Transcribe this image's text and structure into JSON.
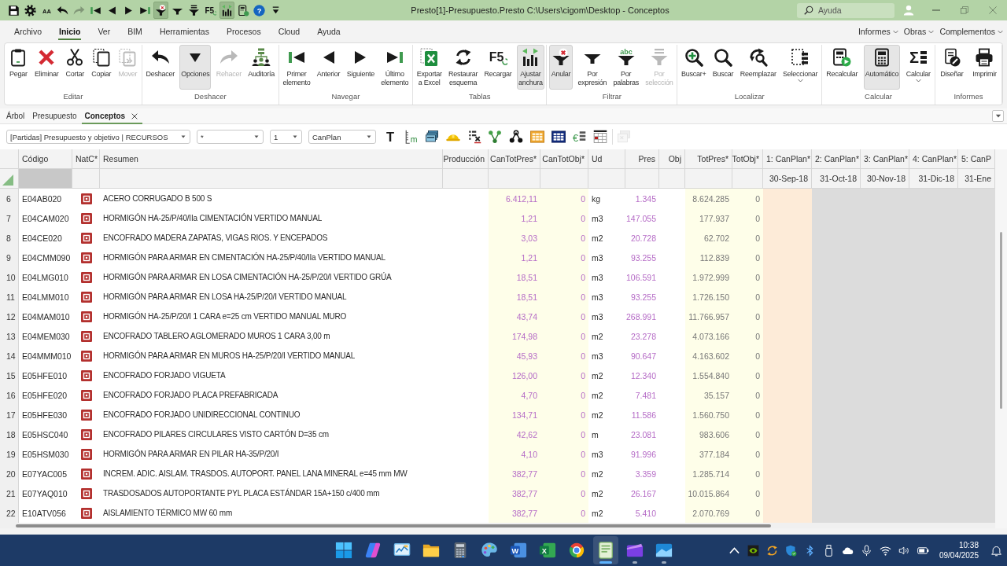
{
  "title_bar": {
    "quick_access": [
      {
        "kind": "save",
        "pressed": false,
        "disabled": false
      },
      {
        "kind": "settings",
        "pressed": false,
        "disabled": false
      },
      {
        "kind": "font_size",
        "glyph": "AA",
        "pressed": false,
        "disabled": false
      },
      {
        "kind": "undo",
        "pressed": false,
        "disabled": false
      },
      {
        "kind": "redo",
        "pressed": false,
        "disabled": true
      },
      {
        "kind": "first",
        "pressed": false,
        "disabled": false
      },
      {
        "kind": "previous",
        "pressed": false,
        "disabled": false
      },
      {
        "kind": "next",
        "pressed": false,
        "disabled": false
      },
      {
        "kind": "last",
        "pressed": false,
        "disabled": false
      },
      {
        "kind": "clear_filter",
        "pressed": true,
        "disabled": false
      },
      {
        "kind": "filter_expression",
        "pressed": false,
        "disabled": false
      },
      {
        "kind": "filter_words",
        "pressed": false,
        "disabled": false
      },
      {
        "kind": "reload",
        "glyph": "F5",
        "pressed": false,
        "disabled": false
      },
      {
        "kind": "fit_width",
        "pressed": true,
        "disabled": false
      },
      {
        "kind": "calc_sheet",
        "pressed": false,
        "disabled": false
      },
      {
        "kind": "help",
        "glyph": "?",
        "pressed": false,
        "disabled": false
      },
      {
        "kind": "customize",
        "pressed": false,
        "disabled": false
      }
    ],
    "title": "Presto[1]-Presupuesto.Presto C:\\Users\\cigom\\Desktop - Conceptos",
    "search": {
      "placeholder": "Ayuda"
    }
  },
  "menu_bar": {
    "tabs": [
      {
        "label": "Archivo",
        "selected": false
      },
      {
        "label": "Inicio",
        "selected": true
      },
      {
        "label": "Ver",
        "selected": false
      },
      {
        "label": "BIM",
        "selected": false
      },
      {
        "label": "Herramientas",
        "selected": false
      },
      {
        "label": "Procesos",
        "selected": false
      },
      {
        "label": "Cloud",
        "selected": false
      },
      {
        "label": "Ayuda",
        "selected": false
      }
    ],
    "menus": [
      {
        "label": "Informes"
      },
      {
        "label": "Obras"
      },
      {
        "label": "Complementos"
      }
    ]
  },
  "ribbon": {
    "groups": [
      {
        "label": "Editar",
        "buttons": [
          {
            "kind": "paste",
            "label": "Pegar",
            "pressed": false,
            "disabled": false,
            "menu": false
          },
          {
            "kind": "delete",
            "label": "Eliminar",
            "pressed": false,
            "disabled": false,
            "menu": false
          },
          {
            "kind": "cut",
            "label": "Cortar",
            "pressed": false,
            "disabled": false,
            "menu": false
          },
          {
            "kind": "copy",
            "label": "Copiar",
            "pressed": false,
            "disabled": false,
            "menu": false
          },
          {
            "kind": "move",
            "label": "Mover",
            "pressed": false,
            "disabled": true,
            "menu": false
          }
        ]
      },
      {
        "label": "Deshacer",
        "buttons": [
          {
            "kind": "undo",
            "label": "Deshacer",
            "pressed": false,
            "disabled": false,
            "menu": false
          },
          {
            "kind": "options",
            "label": "Opciones",
            "pressed": true,
            "disabled": false,
            "menu": false
          },
          {
            "kind": "redo",
            "label": "Rehacer",
            "pressed": false,
            "disabled": true,
            "menu": false
          },
          {
            "kind": "audit",
            "label": "Auditoría",
            "pressed": false,
            "disabled": false,
            "menu": false
          }
        ]
      },
      {
        "label": "Navegar",
        "buttons": [
          {
            "kind": "first",
            "label": "Primer\nelemento",
            "pressed": false,
            "disabled": false,
            "menu": false
          },
          {
            "kind": "previous",
            "label": "Anterior",
            "pressed": false,
            "disabled": false,
            "menu": false
          },
          {
            "kind": "next",
            "label": "Siguiente",
            "pressed": false,
            "disabled": false,
            "menu": false
          },
          {
            "kind": "last",
            "label": "Último\nelemento",
            "pressed": false,
            "disabled": false,
            "menu": false
          }
        ]
      },
      {
        "label": "Tablas",
        "buttons": [
          {
            "kind": "export_excel",
            "label": "Exportar\na Excel",
            "pressed": false,
            "disabled": false,
            "menu": false
          },
          {
            "kind": "restore_layout",
            "label": "Restaurar\nesquema",
            "pressed": false,
            "disabled": false,
            "menu": false
          },
          {
            "kind": "reload",
            "glyph": "F5",
            "label": "Recargar",
            "pressed": false,
            "disabled": false,
            "menu": false
          },
          {
            "kind": "fit_width",
            "label": "Ajustar\nanchura",
            "pressed": true,
            "disabled": false,
            "menu": false
          }
        ]
      },
      {
        "label": "Filtrar",
        "buttons": [
          {
            "kind": "clear_filter",
            "label": "Anular",
            "pressed": true,
            "disabled": false,
            "menu": false
          },
          {
            "kind": "filter_expression",
            "label": "Por\nexpresión",
            "pressed": false,
            "disabled": false,
            "menu": false
          },
          {
            "kind": "filter_words",
            "glyph": "abc",
            "label": "Por\npalabras",
            "pressed": false,
            "disabled": false,
            "menu": false
          },
          {
            "kind": "filter_selection",
            "label": "Por\nselección",
            "pressed": false,
            "disabled": true,
            "menu": false
          }
        ]
      },
      {
        "label": "Localizar",
        "buttons": [
          {
            "kind": "search_plus",
            "label": "Buscar+",
            "pressed": false,
            "disabled": false,
            "menu": false
          },
          {
            "kind": "search",
            "label": "Buscar",
            "pressed": false,
            "disabled": false,
            "menu": false
          },
          {
            "kind": "replace",
            "label": "Reemplazar",
            "pressed": false,
            "disabled": false,
            "menu": false
          },
          {
            "kind": "select",
            "label": "Seleccionar",
            "pressed": false,
            "disabled": false,
            "menu": true
          }
        ]
      },
      {
        "label": "Calcular",
        "buttons": [
          {
            "kind": "recalculate",
            "label": "Recalcular",
            "pressed": false,
            "disabled": false,
            "menu": false
          },
          {
            "kind": "automatic",
            "label": "Automático",
            "pressed": true,
            "disabled": false,
            "menu": false
          },
          {
            "kind": "calculate",
            "glyph": "Σ",
            "label": "Calcular",
            "pressed": false,
            "disabled": false,
            "menu": true
          }
        ]
      },
      {
        "label": "Informes",
        "buttons": [
          {
            "kind": "design",
            "label": "Diseñar",
            "pressed": false,
            "disabled": false,
            "menu": false
          },
          {
            "kind": "print",
            "label": "Imprimir",
            "pressed": false,
            "disabled": false,
            "menu": false
          }
        ]
      }
    ]
  },
  "doc_tabs": [
    {
      "label": "Árbol",
      "selected": false
    },
    {
      "label": "Presupuesto",
      "selected": false
    },
    {
      "label": "Conceptos",
      "selected": true
    }
  ],
  "toolbar": {
    "selectors": [
      {
        "value": "[Partidas] Presupuesto y objetivo | RECURSOS"
      },
      {
        "value": "*"
      },
      {
        "value": "1"
      },
      {
        "value": "CanPlan"
      }
    ],
    "tools": [
      {
        "kind": "text_tool",
        "glyph": "T",
        "disabled": false
      },
      {
        "kind": "ruler",
        "glyph": "m",
        "disabled": false
      },
      {
        "kind": "layers",
        "disabled": false
      },
      {
        "kind": "helmet",
        "disabled": false
      },
      {
        "kind": "list_remove",
        "disabled": false
      },
      {
        "kind": "branch",
        "disabled": false
      },
      {
        "kind": "tree",
        "disabled": false
      },
      {
        "kind": "grid_filled",
        "disabled": false
      },
      {
        "kind": "grid_table",
        "disabled": false
      },
      {
        "kind": "euro_list",
        "glyph": "€",
        "disabled": false
      },
      {
        "kind": "calendar",
        "disabled": false
      },
      {
        "kind": "sheets",
        "disabled": true
      }
    ]
  },
  "table": {
    "columns": [
      {
        "label": "Código",
        "selected": true
      },
      {
        "label": "NatC*",
        "selected": false
      },
      {
        "label": "Resumen",
        "selected": false
      },
      {
        "label": "Producción",
        "selected": false
      },
      {
        "label": "CanTotPres*",
        "selected": false
      },
      {
        "label": "CanTotObj*",
        "selected": false
      },
      {
        "label": "Ud",
        "selected": false
      },
      {
        "label": "Pres",
        "selected": false
      },
      {
        "label": "Obj",
        "selected": false
      },
      {
        "label": "TotPres*",
        "selected": false
      },
      {
        "label": "TotObj*",
        "selected": false
      },
      {
        "label": "1: CanPlan*",
        "date": "30-Sep-18",
        "selected": false
      },
      {
        "label": "2: CanPlan*",
        "date": "31-Oct-18",
        "selected": false
      },
      {
        "label": "3: CanPlan*",
        "date": "30-Nov-18",
        "selected": false
      },
      {
        "label": "4: CanPlan*",
        "date": "31-Dic-18",
        "selected": false
      },
      {
        "label": "5: CanP",
        "date": "31-Ene",
        "selected": false
      }
    ],
    "rows": [
      {
        "number": "6",
        "code": "E04AB020",
        "summary": "ACERO CORRUGADO B 500 S",
        "can_tot_pres": "6.412,11",
        "can_tot_obj": "0",
        "unit": "kg",
        "pres": "1.345",
        "tot_pres": "8.624.285",
        "tot_obj": "0"
      },
      {
        "number": "7",
        "code": "E04CAM020",
        "summary": "HORMIGÓN HA-25/P/40/IIa CIMENTACIÓN VERTIDO MANUAL",
        "can_tot_pres": "1,21",
        "can_tot_obj": "0",
        "unit": "m3",
        "pres": "147.055",
        "tot_pres": "177.937",
        "tot_obj": "0"
      },
      {
        "number": "8",
        "code": "E04CE020",
        "summary": "ENCOFRADO MADERA ZAPATAS, VIGAS RIOS. Y ENCEPADOS",
        "can_tot_pres": "3,03",
        "can_tot_obj": "0",
        "unit": "m2",
        "pres": "20.728",
        "tot_pres": "62.702",
        "tot_obj": "0"
      },
      {
        "number": "9",
        "code": "E04CMM090",
        "summary": "HORMIGÓN PARA ARMAR EN CIMENTACIÓN HA-25/P/40/IIa VERTIDO MANUAL",
        "can_tot_pres": "1,21",
        "can_tot_obj": "0",
        "unit": "m3",
        "pres": "93.255",
        "tot_pres": "112.839",
        "tot_obj": "0"
      },
      {
        "number": "10",
        "code": "E04LMG010",
        "summary": "HORMIGÓN PARA ARMAR EN LOSA CIMENTACIÓN HA-25/P/20/I VERTIDO GRÚA",
        "can_tot_pres": "18,51",
        "can_tot_obj": "0",
        "unit": "m3",
        "pres": "106.591",
        "tot_pres": "1.972.999",
        "tot_obj": "0"
      },
      {
        "number": "11",
        "code": "E04LMM010",
        "summary": "HORMIGÓN PARA ARMAR EN LOSA HA-25/P/20/I VERTIDO MANUAL",
        "can_tot_pres": "18,51",
        "can_tot_obj": "0",
        "unit": "m3",
        "pres": "93.255",
        "tot_pres": "1.726.150",
        "tot_obj": "0"
      },
      {
        "number": "12",
        "code": "E04MAM010",
        "summary": "HORMIGÓN HA-25/P/20/I 1 CARA e=25 cm VERTIDO MANUAL MURO",
        "can_tot_pres": "43,74",
        "can_tot_obj": "0",
        "unit": "m3",
        "pres": "268.991",
        "tot_pres": "11.766.957",
        "tot_obj": "0"
      },
      {
        "number": "13",
        "code": "E04MEM030",
        "summary": "ENCOFRADO TABLERO AGLOMERADO MUROS 1 CARA 3,00 m",
        "can_tot_pres": "174,98",
        "can_tot_obj": "0",
        "unit": "m2",
        "pres": "23.278",
        "tot_pres": "4.073.166",
        "tot_obj": "0"
      },
      {
        "number": "14",
        "code": "E04MMM010",
        "summary": "HORMIGÓN PARA ARMAR EN MUROS HA-25/P/20/I VERTIDO MANUAL",
        "can_tot_pres": "45,93",
        "can_tot_obj": "0",
        "unit": "m3",
        "pres": "90.647",
        "tot_pres": "4.163.602",
        "tot_obj": "0"
      },
      {
        "number": "15",
        "code": "E05HFE010",
        "summary": "ENCOFRADO FORJADO VIGUETA",
        "can_tot_pres": "126,00",
        "can_tot_obj": "0",
        "unit": "m2",
        "pres": "12.340",
        "tot_pres": "1.554.840",
        "tot_obj": "0"
      },
      {
        "number": "16",
        "code": "E05HFE020",
        "summary": "ENCOFRADO FORJADO PLACA PREFABRICADA",
        "can_tot_pres": "4,70",
        "can_tot_obj": "0",
        "unit": "m2",
        "pres": "7.481",
        "tot_pres": "35.157",
        "tot_obj": "0"
      },
      {
        "number": "17",
        "code": "E05HFE030",
        "summary": "ENCOFRADO FORJADO UNIDIRECCIONAL CONTINUO",
        "can_tot_pres": "134,71",
        "can_tot_obj": "0",
        "unit": "m2",
        "pres": "11.586",
        "tot_pres": "1.560.750",
        "tot_obj": "0"
      },
      {
        "number": "18",
        "code": "E05HSC040",
        "summary": "ENCOFRADO PILARES CIRCULARES VISTO CARTÓN D=35 cm",
        "can_tot_pres": "42,62",
        "can_tot_obj": "0",
        "unit": "m",
        "pres": "23.081",
        "tot_pres": "983.606",
        "tot_obj": "0"
      },
      {
        "number": "19",
        "code": "E05HSM030",
        "summary": "HORMIGÓN PARA ARMAR EN PILAR HA-35/P/20/I",
        "can_tot_pres": "4,10",
        "can_tot_obj": "0",
        "unit": "m3",
        "pres": "91.996",
        "tot_pres": "377.184",
        "tot_obj": "0"
      },
      {
        "number": "20",
        "code": "E07YAC005",
        "summary": "INCREM. ADIC. AISLAM. TRASDOS. AUTOPORT. PANEL LANA MINERAL e=45 mm MW",
        "can_tot_pres": "382,77",
        "can_tot_obj": "0",
        "unit": "m2",
        "pres": "3.359",
        "tot_pres": "1.285.714",
        "tot_obj": "0"
      },
      {
        "number": "21",
        "code": "E07YAQ010",
        "summary": "TRASDOSADOS AUTOPORTANTE PYL PLACA ESTÁNDAR 15A+150 c/400 mm",
        "can_tot_pres": "382,77",
        "can_tot_obj": "0",
        "unit": "m2",
        "pres": "26.167",
        "tot_pres": "10.015.864",
        "tot_obj": "0"
      },
      {
        "number": "22",
        "code": "E10ATV056",
        "summary": "AISLAMIENTO TÉRMICO MW 60 mm",
        "can_tot_pres": "382,77",
        "can_tot_obj": "0",
        "unit": "m2",
        "pres": "5.410",
        "tot_pres": "2.070.769",
        "tot_obj": "0"
      }
    ]
  },
  "taskbar": {
    "apps": [
      {
        "kind": "start",
        "running": false,
        "selected": false
      },
      {
        "kind": "copilot",
        "running": false,
        "selected": false
      },
      {
        "kind": "monitor",
        "running": false,
        "selected": false
      },
      {
        "kind": "folder",
        "running": false,
        "selected": false
      },
      {
        "kind": "calculator",
        "running": false,
        "selected": false
      },
      {
        "kind": "palette",
        "running": false,
        "selected": false
      },
      {
        "kind": "word",
        "glyph": "W",
        "running": false,
        "selected": false
      },
      {
        "kind": "excel",
        "glyph": "X",
        "running": false,
        "selected": false
      },
      {
        "kind": "browser",
        "running": false,
        "selected": false
      },
      {
        "kind": "presto",
        "running": true,
        "selected": true
      },
      {
        "kind": "video",
        "running": true,
        "selected": false
      },
      {
        "kind": "photos",
        "running": true,
        "selected": false
      }
    ],
    "tray": [
      {
        "kind": "chevron_up"
      },
      {
        "kind": "gpu"
      },
      {
        "kind": "sync"
      },
      {
        "kind": "shield"
      },
      {
        "kind": "bluetooth"
      },
      {
        "kind": "usb"
      },
      {
        "kind": "cloud"
      },
      {
        "kind": "mic"
      },
      {
        "kind": "wifi"
      },
      {
        "kind": "volume"
      },
      {
        "kind": "battery"
      }
    ],
    "time": "10:38",
    "date": "09/04/2025"
  }
}
